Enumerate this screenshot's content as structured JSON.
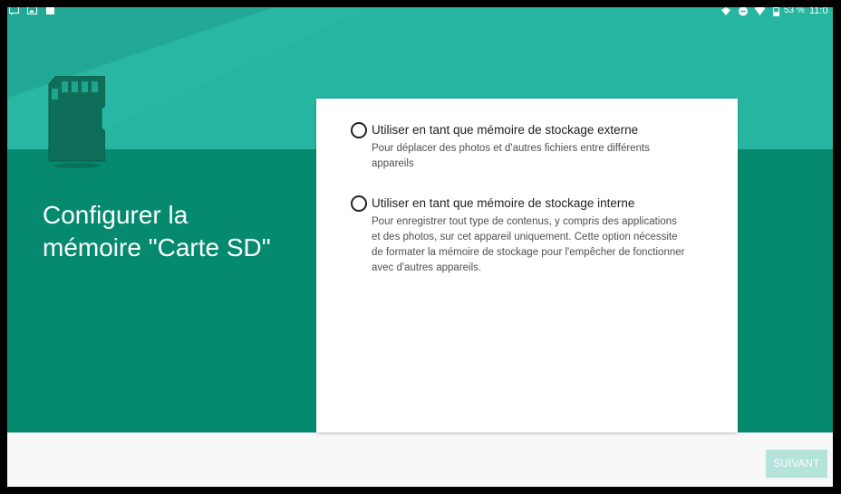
{
  "status_bar": {
    "battery_percent": "53 %",
    "time": "11:0",
    "icons_left": [
      "message-icon",
      "image-icon",
      "square-icon"
    ],
    "icons_right": [
      "nfc-icon",
      "do-not-disturb-icon",
      "wifi-icon",
      "battery-icon"
    ]
  },
  "title": {
    "line1": "Configurer la",
    "line2": "mémoire \"Carte SD\""
  },
  "options": [
    {
      "label": "Utiliser en tant que mémoire de stockage externe",
      "description_lines": [
        "Pour déplacer des photos et d'autres fichiers entre différents",
        "appareils"
      ],
      "selected": false
    },
    {
      "label": "Utiliser en tant que mémoire de stockage interne",
      "description_lines": [
        "Pour enregistrer tout type de contenus, y compris des applications",
        "et des photos, sur cet appareil uniquement. Cette option nécessite",
        "de formater la mémoire de stockage pour l'empêcher de fonctionner",
        "avec d'autres appareils."
      ],
      "selected": false
    }
  ],
  "next_button": {
    "label": "SUIVANT",
    "enabled": false
  },
  "colors": {
    "header_light": "#26b5a0",
    "header_dark": "#058a6f",
    "button_disabled": "#b3e3da"
  }
}
